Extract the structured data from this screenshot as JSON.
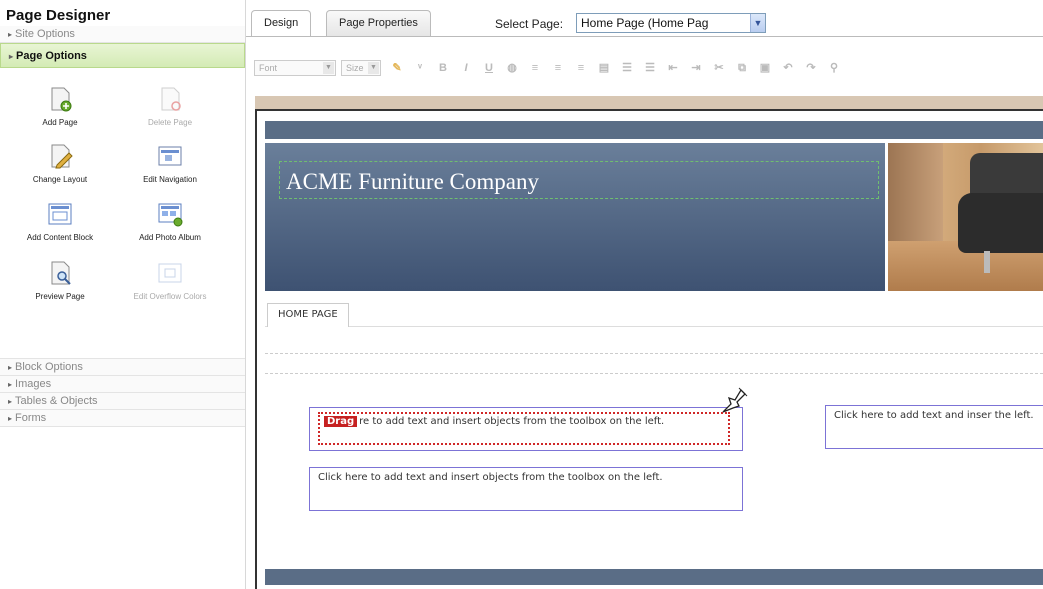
{
  "sidebar": {
    "title": "Page Designer",
    "sections_top": [
      {
        "label": "Site Options",
        "active": false
      },
      {
        "label": "Page Options",
        "active": true
      }
    ],
    "tools": [
      {
        "label": "Add Page",
        "enabled": true
      },
      {
        "label": "Delete Page",
        "enabled": false
      },
      {
        "label": "Change Layout",
        "enabled": true
      },
      {
        "label": "Edit Navigation",
        "enabled": true
      },
      {
        "label": "Add Content Block",
        "enabled": true
      },
      {
        "label": "Add Photo Album",
        "enabled": true
      },
      {
        "label": "Preview Page",
        "enabled": true
      },
      {
        "label": "Edit Overflow Colors",
        "enabled": false
      }
    ],
    "sections_bottom": [
      {
        "label": "Block Options"
      },
      {
        "label": "Images"
      },
      {
        "label": "Tables & Objects"
      },
      {
        "label": "Forms"
      }
    ]
  },
  "tabs": [
    {
      "label": "Design",
      "active": true
    },
    {
      "label": "Page Properties",
      "active": false
    }
  ],
  "select_page": {
    "label": "Select Page:",
    "value": "Home Page (Home Pag"
  },
  "toolbar": {
    "font_placeholder": "Font",
    "size_placeholder": "Size"
  },
  "canvas": {
    "site_title": "ACME Furniture Company",
    "nav_item": "HOME PAGE",
    "drag_label": "Drag",
    "block1_text": "re to add text and insert objects from the toolbox on the left.",
    "block2_text": "Click here to add text and insert objects from the toolbox on the left.",
    "block3_text": "Click here to add text and inser the left."
  },
  "colors": {
    "header_bg": "#4f6482",
    "active_section": "#d4ebb5",
    "drag_red": "#c62121",
    "block_border": "#7c73d6",
    "canvas_frame": "#d8c7b3"
  }
}
